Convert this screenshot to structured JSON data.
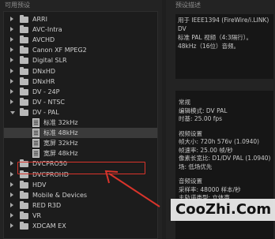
{
  "presets_header": "可用预设",
  "description_header": "预设描述",
  "tree": [
    {
      "label": "ARRI",
      "type": "folder",
      "expanded": false,
      "indent": 0
    },
    {
      "label": "AVC-Intra",
      "type": "folder",
      "expanded": false,
      "indent": 0
    },
    {
      "label": "AVCHD",
      "type": "folder",
      "expanded": false,
      "indent": 0
    },
    {
      "label": "Canon XF MPEG2",
      "type": "folder",
      "expanded": false,
      "indent": 0
    },
    {
      "label": "Digital SLR",
      "type": "folder",
      "expanded": false,
      "indent": 0
    },
    {
      "label": "DNxHD",
      "type": "folder",
      "expanded": false,
      "indent": 0
    },
    {
      "label": "DNxHR",
      "type": "folder",
      "expanded": false,
      "indent": 0
    },
    {
      "label": "DV - 24P",
      "type": "folder",
      "expanded": false,
      "indent": 0
    },
    {
      "label": "DV - NTSC",
      "type": "folder",
      "expanded": false,
      "indent": 0
    },
    {
      "label": "DV - PAL",
      "type": "folder",
      "expanded": true,
      "indent": 0
    },
    {
      "label": "标准 32kHz",
      "type": "file",
      "indent": 1
    },
    {
      "label": "标准 48kHz",
      "type": "file",
      "indent": 1,
      "selected": true
    },
    {
      "label": "宽屏 32kHz",
      "type": "file",
      "indent": 1
    },
    {
      "label": "宽屏 48kHz",
      "type": "file",
      "indent": 1
    },
    {
      "label": "DVCPRO50",
      "type": "folder",
      "expanded": false,
      "indent": 0
    },
    {
      "label": "DVCPROHD",
      "type": "folder",
      "expanded": false,
      "indent": 0
    },
    {
      "label": "HDV",
      "type": "folder",
      "expanded": false,
      "indent": 0,
      "highlighted": true
    },
    {
      "label": "Mobile & Devices",
      "type": "folder",
      "expanded": false,
      "indent": 0
    },
    {
      "label": "RED R3D",
      "type": "folder",
      "expanded": false,
      "indent": 0
    },
    {
      "label": "VR",
      "type": "folder",
      "expanded": false,
      "indent": 0
    },
    {
      "label": "XDCAM EX",
      "type": "folder",
      "expanded": false,
      "indent": 0
    }
  ],
  "description_lines": [
    "用于 IEEE1394 (FireWire/i.LINK) DV",
    "标准 PAL 视频（4:3隔行）。",
    "48kHz（16位）音频。"
  ],
  "info": {
    "general_title": "常规",
    "edit_mode": "编辑模式: DV PAL",
    "timebase": "时基: 25.00 fps",
    "video_title": "视频设置",
    "frame_size": "帧大小: 720h 576v (1.0940)",
    "frame_rate": "帧速率: 25.00 帧/秒",
    "pixel_aspect": "像素长宽比: D1/DV PAL (1.0940)",
    "fields": "场: 低场优先",
    "audio_title": "音频设置",
    "sample_rate": "采样率: 48000 样本/秒",
    "audio_more": "主轨道类型: 立体声"
  },
  "watermark": "CooZhi.Com",
  "colors": {
    "highlight_box": "#d9342b",
    "selected_row": "#3a3a3a"
  }
}
